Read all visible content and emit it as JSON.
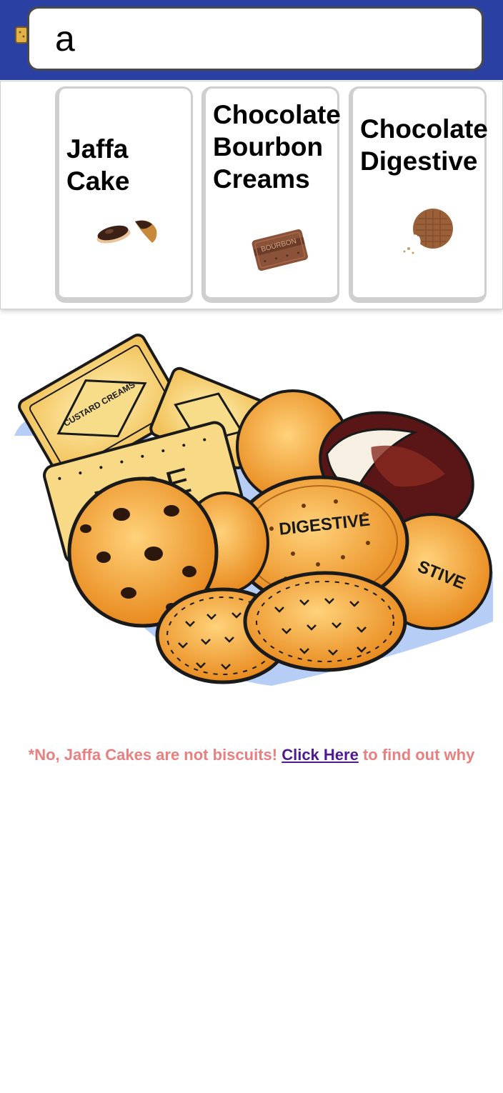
{
  "search": {
    "value": "a"
  },
  "results": [
    {
      "title": "Jaffa\nCake",
      "image": "jaffa-cake-image"
    },
    {
      "title": "Chocolate\nBourbon\nCreams",
      "image": "bourbon-biscuit-image",
      "biscuit_text": "BOURBON"
    },
    {
      "title": "Chocolate\nDigestive",
      "image": "chocolate-digestive-image"
    }
  ],
  "illustration": {
    "name": "biscuit-pile-illustration",
    "labels": {
      "custard": "CUSTARD CREAMS",
      "nice": "NICE",
      "digestive": "DIGESTIVE",
      "digestive_back": "STIVE"
    }
  },
  "footnote": {
    "prefix": "*No, Jaffa Cakes are not biscuits! ",
    "link": "Click Here",
    "suffix": " to find out why"
  },
  "colors": {
    "header": "#2a41a3",
    "footnote": "#e88080",
    "link": "#4d1b8f"
  }
}
